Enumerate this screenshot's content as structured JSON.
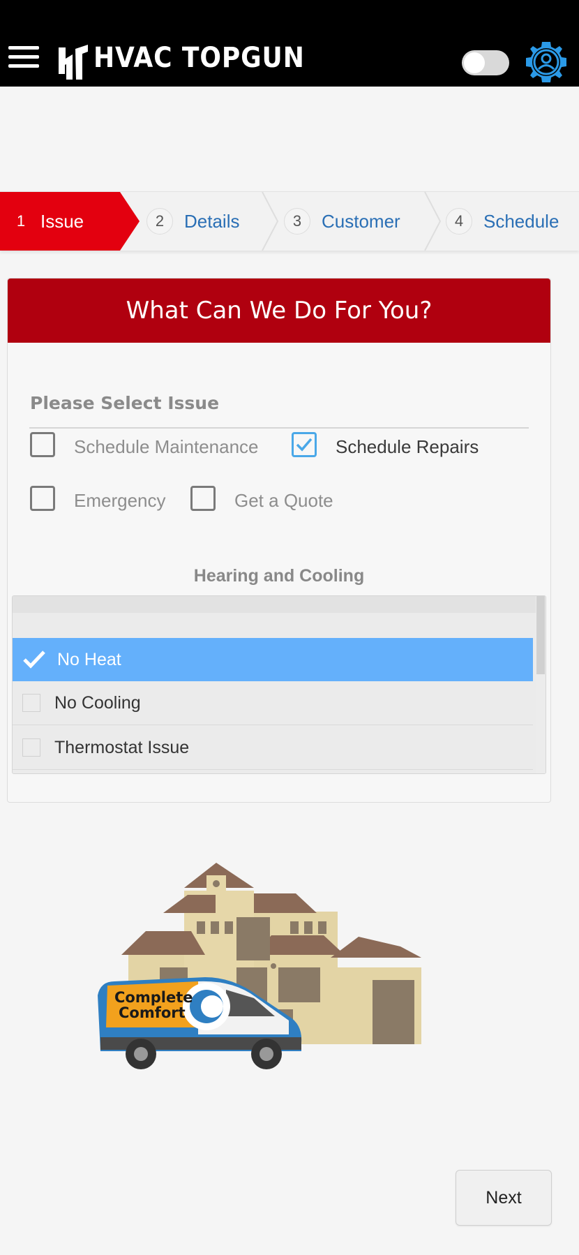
{
  "app": {
    "name": "HVAC TOPGUN"
  },
  "header": {
    "menu_icon": "menu-icon",
    "account_icon": "account-settings-icon"
  },
  "stepper": {
    "steps": [
      {
        "number": "1",
        "label": "Issue",
        "active": true
      },
      {
        "number": "2",
        "label": "Details",
        "active": false
      },
      {
        "number": "3",
        "label": "Customer",
        "active": false
      },
      {
        "number": "4",
        "label": "Schedule",
        "active": false
      }
    ]
  },
  "card": {
    "title": "What Can We Do For You?",
    "issue_label": "Please Select Issue",
    "options": [
      {
        "label": "Schedule Maintenance",
        "checked": false
      },
      {
        "label": "Schedule Repairs",
        "checked": true
      },
      {
        "label": "Emergency",
        "checked": false
      },
      {
        "label": "Get a Quote",
        "checked": false
      }
    ],
    "section_heading": "Hearing and Cooling",
    "issues_list": [
      {
        "label": "No Heat",
        "selected": true
      },
      {
        "label": "No Cooling",
        "selected": false
      },
      {
        "label": "Thermostat Issue",
        "selected": false
      }
    ]
  },
  "illustration": {
    "van_brand_line1": "Complete",
    "van_brand_line2": "Comfort"
  },
  "footer": {
    "next_label": "Next"
  },
  "colors": {
    "accent_red": "#e3000f",
    "card_header": "#b0000f",
    "link_blue": "#2a6fb5",
    "selected_blue": "#64b0fb"
  }
}
